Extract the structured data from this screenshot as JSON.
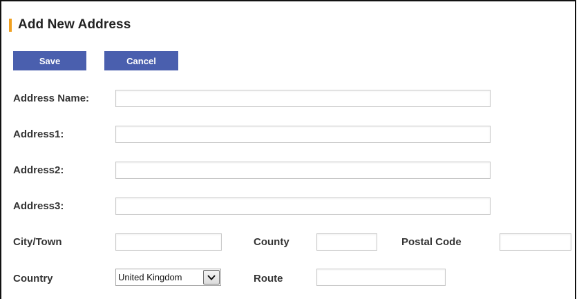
{
  "form": {
    "title": "Add New Address",
    "title_accent_color": "#f0a020",
    "button_color": "#4a5fae",
    "buttons": {
      "save_label": "Save",
      "cancel_label": "Cancel"
    },
    "fields": {
      "address_name": {
        "label": "Address Name:",
        "value": ""
      },
      "address1": {
        "label": "Address1:",
        "value": ""
      },
      "address2": {
        "label": "Address2:",
        "value": ""
      },
      "address3": {
        "label": "Address3:",
        "value": ""
      },
      "city_town": {
        "label": "City/Town",
        "value": ""
      },
      "county": {
        "label": "County",
        "value": ""
      },
      "postal_code": {
        "label": "Postal Code",
        "value": ""
      },
      "country": {
        "label": "Country",
        "selected": "United Kingdom",
        "icon": "chevron-down-icon"
      },
      "route": {
        "label": "Route",
        "value": ""
      }
    }
  }
}
